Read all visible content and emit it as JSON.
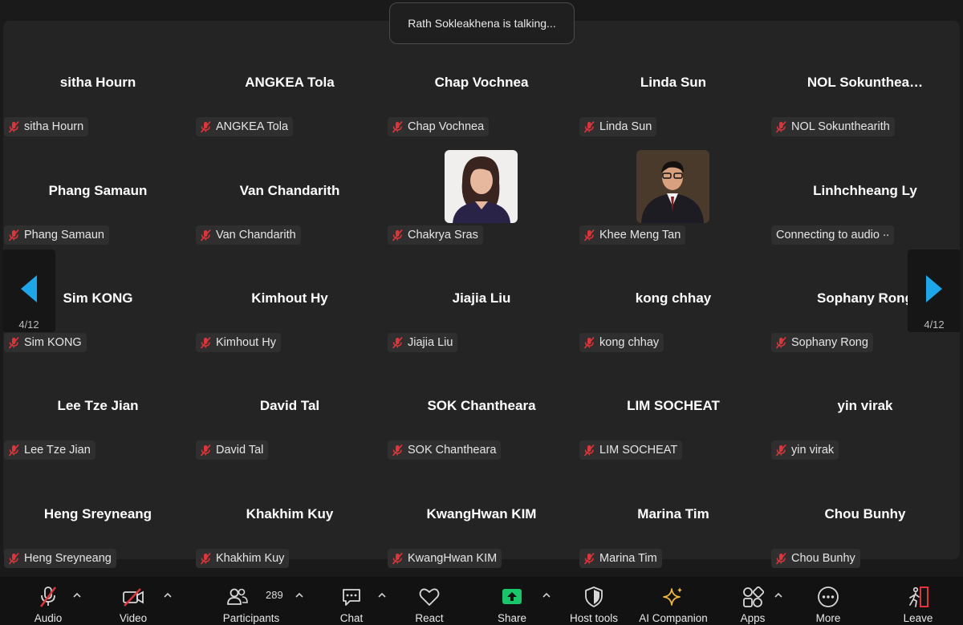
{
  "toast": "Rath Sokleakhena is talking...",
  "rows": [
    [
      {
        "big": "sitha Hourn",
        "label": "sitha Hourn",
        "photo": null,
        "mic": true
      },
      {
        "big": "ANGKEA Tola",
        "label": "ANGKEA Tola",
        "photo": null,
        "mic": true
      },
      {
        "big": "Chap Vochnea",
        "label": "Chap Vochnea",
        "photo": null,
        "mic": true
      },
      {
        "big": "Linda Sun",
        "label": "Linda Sun",
        "photo": null,
        "mic": true
      },
      {
        "big": "NOL  Sokunthea…",
        "label": "NOL Sokunthearith",
        "photo": null,
        "mic": true
      }
    ],
    [
      {
        "big": "Phang Samaun",
        "label": "Phang Samaun",
        "photo": null,
        "mic": true
      },
      {
        "big": "Van Chandarith",
        "label": "Van Chandarith",
        "photo": null,
        "mic": true
      },
      {
        "big": "",
        "label": "Chakrya Sras",
        "photo": "woman",
        "mic": true
      },
      {
        "big": "",
        "label": "Khee Meng Tan",
        "photo": "man",
        "mic": true
      },
      {
        "big": "Linhchheang Ly",
        "label": "Connecting to audio ∙∙",
        "photo": null,
        "mic": false
      }
    ],
    [
      {
        "big": "Sim KONG",
        "label": "Sim KONG",
        "photo": null,
        "mic": true
      },
      {
        "big": "Kimhout Hy",
        "label": "Kimhout Hy",
        "photo": null,
        "mic": true
      },
      {
        "big": "Jiajia Liu",
        "label": "Jiajia Liu",
        "photo": null,
        "mic": true
      },
      {
        "big": "kong chhay",
        "label": "kong chhay",
        "photo": null,
        "mic": true
      },
      {
        "big": "Sophany Rong",
        "label": "Sophany Rong",
        "photo": null,
        "mic": true
      }
    ],
    [
      {
        "big": "Lee Tze Jian",
        "label": "Lee Tze Jian",
        "photo": null,
        "mic": true
      },
      {
        "big": "David Tal",
        "label": "David Tal",
        "photo": null,
        "mic": true
      },
      {
        "big": "SOK Chantheara",
        "label": "SOK Chantheara",
        "photo": null,
        "mic": true
      },
      {
        "big": "LIM SOCHEAT",
        "label": "LIM SOCHEAT",
        "photo": null,
        "mic": true
      },
      {
        "big": "yin virak",
        "label": "yin virak",
        "photo": null,
        "mic": true
      }
    ],
    [
      {
        "big": "Heng Sreyneang",
        "label": "Heng Sreyneang",
        "photo": null,
        "mic": true
      },
      {
        "big": "Khakhim Kuy",
        "label": "Khakhim Kuy",
        "photo": null,
        "mic": true
      },
      {
        "big": "KwangHwan KIM",
        "label": "KwangHwan KIM",
        "photo": null,
        "mic": true
      },
      {
        "big": "Marina Tim",
        "label": "Marina Tim",
        "photo": null,
        "mic": true
      },
      {
        "big": "Chou Bunhy",
        "label": "Chou Bunhy",
        "photo": null,
        "mic": true
      }
    ]
  ],
  "nav": {
    "left_page": "4/12",
    "right_page": "4/12"
  },
  "toolbar": {
    "audio": "Audio",
    "video": "Video",
    "participants": "Participants",
    "participants_count": "289",
    "chat": "Chat",
    "react": "React",
    "share": "Share",
    "host_tools": "Host tools",
    "ai_companion": "AI Companion",
    "apps": "Apps",
    "more": "More",
    "leave": "Leave"
  },
  "colors": {
    "accent_blue": "#1ea7e8",
    "mute_red": "#e0343a",
    "share_green": "#19c76b",
    "ai_gold": "#f2b63a",
    "leave_red": "#e0343a"
  }
}
